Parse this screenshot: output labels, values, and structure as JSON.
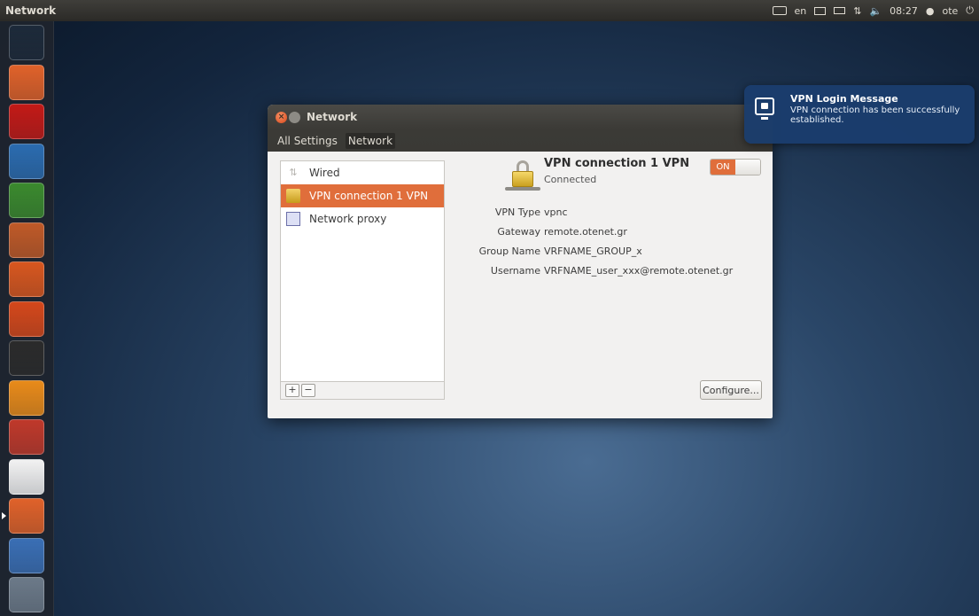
{
  "top_panel": {
    "app_title": "Network",
    "keyboard_layout": "en",
    "clock": "08:27",
    "user": "ote"
  },
  "launcher": {
    "items": [
      {
        "name": "dash-icon",
        "color": "#1d2a3a"
      },
      {
        "name": "files-icon",
        "color": "#e0622a"
      },
      {
        "name": "opera-icon",
        "color": "#c31a17"
      },
      {
        "name": "writer-icon",
        "color": "#2b6cb0"
      },
      {
        "name": "calc-icon",
        "color": "#3b8a2e"
      },
      {
        "name": "impress-icon",
        "color": "#c05a28"
      },
      {
        "name": "software-center-icon",
        "color": "#d8571f"
      },
      {
        "name": "ubuntu-one-icon",
        "color": "#d5481b"
      },
      {
        "name": "terminal-icon",
        "color": "#2b2b2b"
      },
      {
        "name": "vlc-icon",
        "color": "#e98b1a"
      },
      {
        "name": "system-settings-icon",
        "color": "#c0392b"
      },
      {
        "name": "text-editor-icon",
        "color": "#f2f2f2"
      },
      {
        "name": "network-settings-icon",
        "color": "#e0622a"
      },
      {
        "name": "workspace-switcher-icon",
        "color": "#3a6fb5"
      },
      {
        "name": "trash-icon",
        "color": "#6c7a89"
      }
    ]
  },
  "window": {
    "title": "Network",
    "breadcrumbs": [
      "All Settings",
      "Network"
    ],
    "connections": [
      {
        "label": "Wired",
        "icon": "wired-icon"
      },
      {
        "label": "VPN connection 1 VPN",
        "icon": "vpn-lock-icon",
        "selected": true
      },
      {
        "label": "Network proxy",
        "icon": "proxy-icon"
      }
    ],
    "list_buttons": {
      "add": "+",
      "remove": "−"
    },
    "detail": {
      "name": "VPN connection 1 VPN",
      "status": "Connected",
      "toggle": "ON",
      "properties": [
        {
          "label": "VPN Type",
          "value": "vpnc"
        },
        {
          "label": "Gateway",
          "value": "remote.otenet.gr"
        },
        {
          "label": "Group Name",
          "value": "VRFNAME_GROUP_x"
        },
        {
          "label": "Username",
          "value": "VRFNAME_user_xxx@remote.otenet.gr"
        }
      ],
      "configure_label": "Configure..."
    }
  },
  "notification": {
    "title": "VPN Login Message",
    "body": "VPN connection has been successfully established."
  },
  "colors": {
    "accent": "#e06e3b",
    "notification_bg": "#1a3d6e"
  }
}
